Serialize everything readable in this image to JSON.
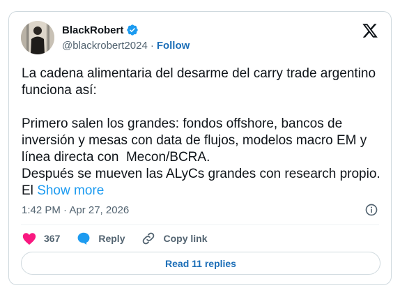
{
  "author": {
    "display_name": "BlackRobert",
    "handle": "@blackrobert2024",
    "separator": "·",
    "follow_label": "Follow",
    "verified_color": "#1d9bf0"
  },
  "tweet": {
    "text": "La cadena alimentaria del desarme del carry trade argentino funciona así:\n\nPrimero salen los grandes: fondos offshore, bancos de inversión y mesas con data de flujos, modelos macro EM y línea directa con  Mecon/BCRA.\nDespués se mueven las ALyCs grandes con research propio. El ",
    "show_more_label": "Show more"
  },
  "meta": {
    "timestamp": "1:42 PM · Apr 27, 2026"
  },
  "actions": {
    "likes_count": "367",
    "reply_label": "Reply",
    "copy_link_label": "Copy link",
    "like_color": "#f91880"
  },
  "footer": {
    "read_replies_label": "Read 11 replies"
  },
  "icons": [
    "avatar",
    "verified-badge-icon",
    "x-logo-icon",
    "info-icon",
    "heart-icon",
    "reply-bubble-icon",
    "link-icon"
  ]
}
